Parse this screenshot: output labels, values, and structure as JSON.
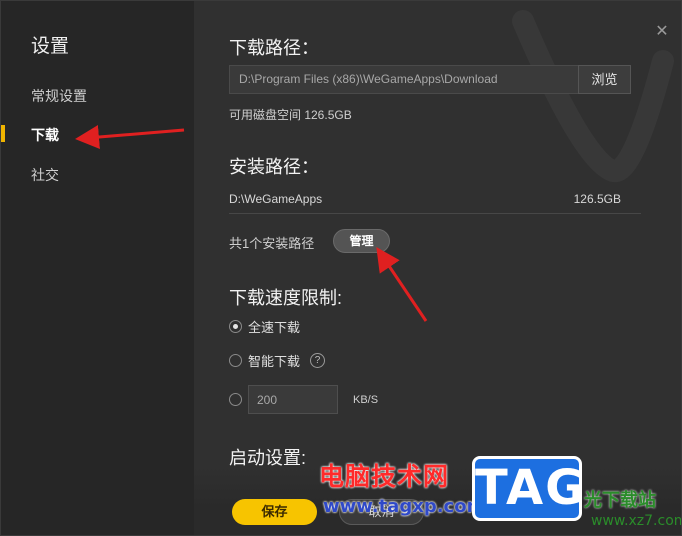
{
  "sidebar": {
    "title": "设置",
    "items": [
      {
        "label": "常规设置",
        "active": false
      },
      {
        "label": "下载",
        "active": true
      },
      {
        "label": "社交",
        "active": false
      }
    ]
  },
  "download_path": {
    "title": "下载路径：",
    "value": "D:\\Program Files (x86)\\WeGameApps\\Download",
    "browse_label": "浏览",
    "disk_space": "可用磁盘空间 126.5GB"
  },
  "install_path": {
    "title": "安装路径：",
    "path": "D:\\WeGameApps",
    "size": "126.5GB",
    "count_text": "共1个安装路径",
    "manage_label": "管理"
  },
  "speed_limit": {
    "title": "下载速度限制:",
    "options": [
      {
        "label": "全速下载",
        "checked": true
      },
      {
        "label": "智能下载",
        "checked": false
      },
      {
        "label": "",
        "checked": false
      }
    ],
    "help_icon": "?",
    "input_value": "200",
    "unit": "KB/S"
  },
  "startup": {
    "title": "启动设置:"
  },
  "footer": {
    "save_label": "保存",
    "cancel_label": "取消"
  },
  "watermarks": {
    "cn_text": "电脑技术网",
    "url": "www.tagxp.com",
    "tag": "TAG",
    "site": "光下载站",
    "site_url": "www.xz7.com"
  },
  "colors": {
    "accent": "#f7c400",
    "arrow": "#e02020"
  }
}
